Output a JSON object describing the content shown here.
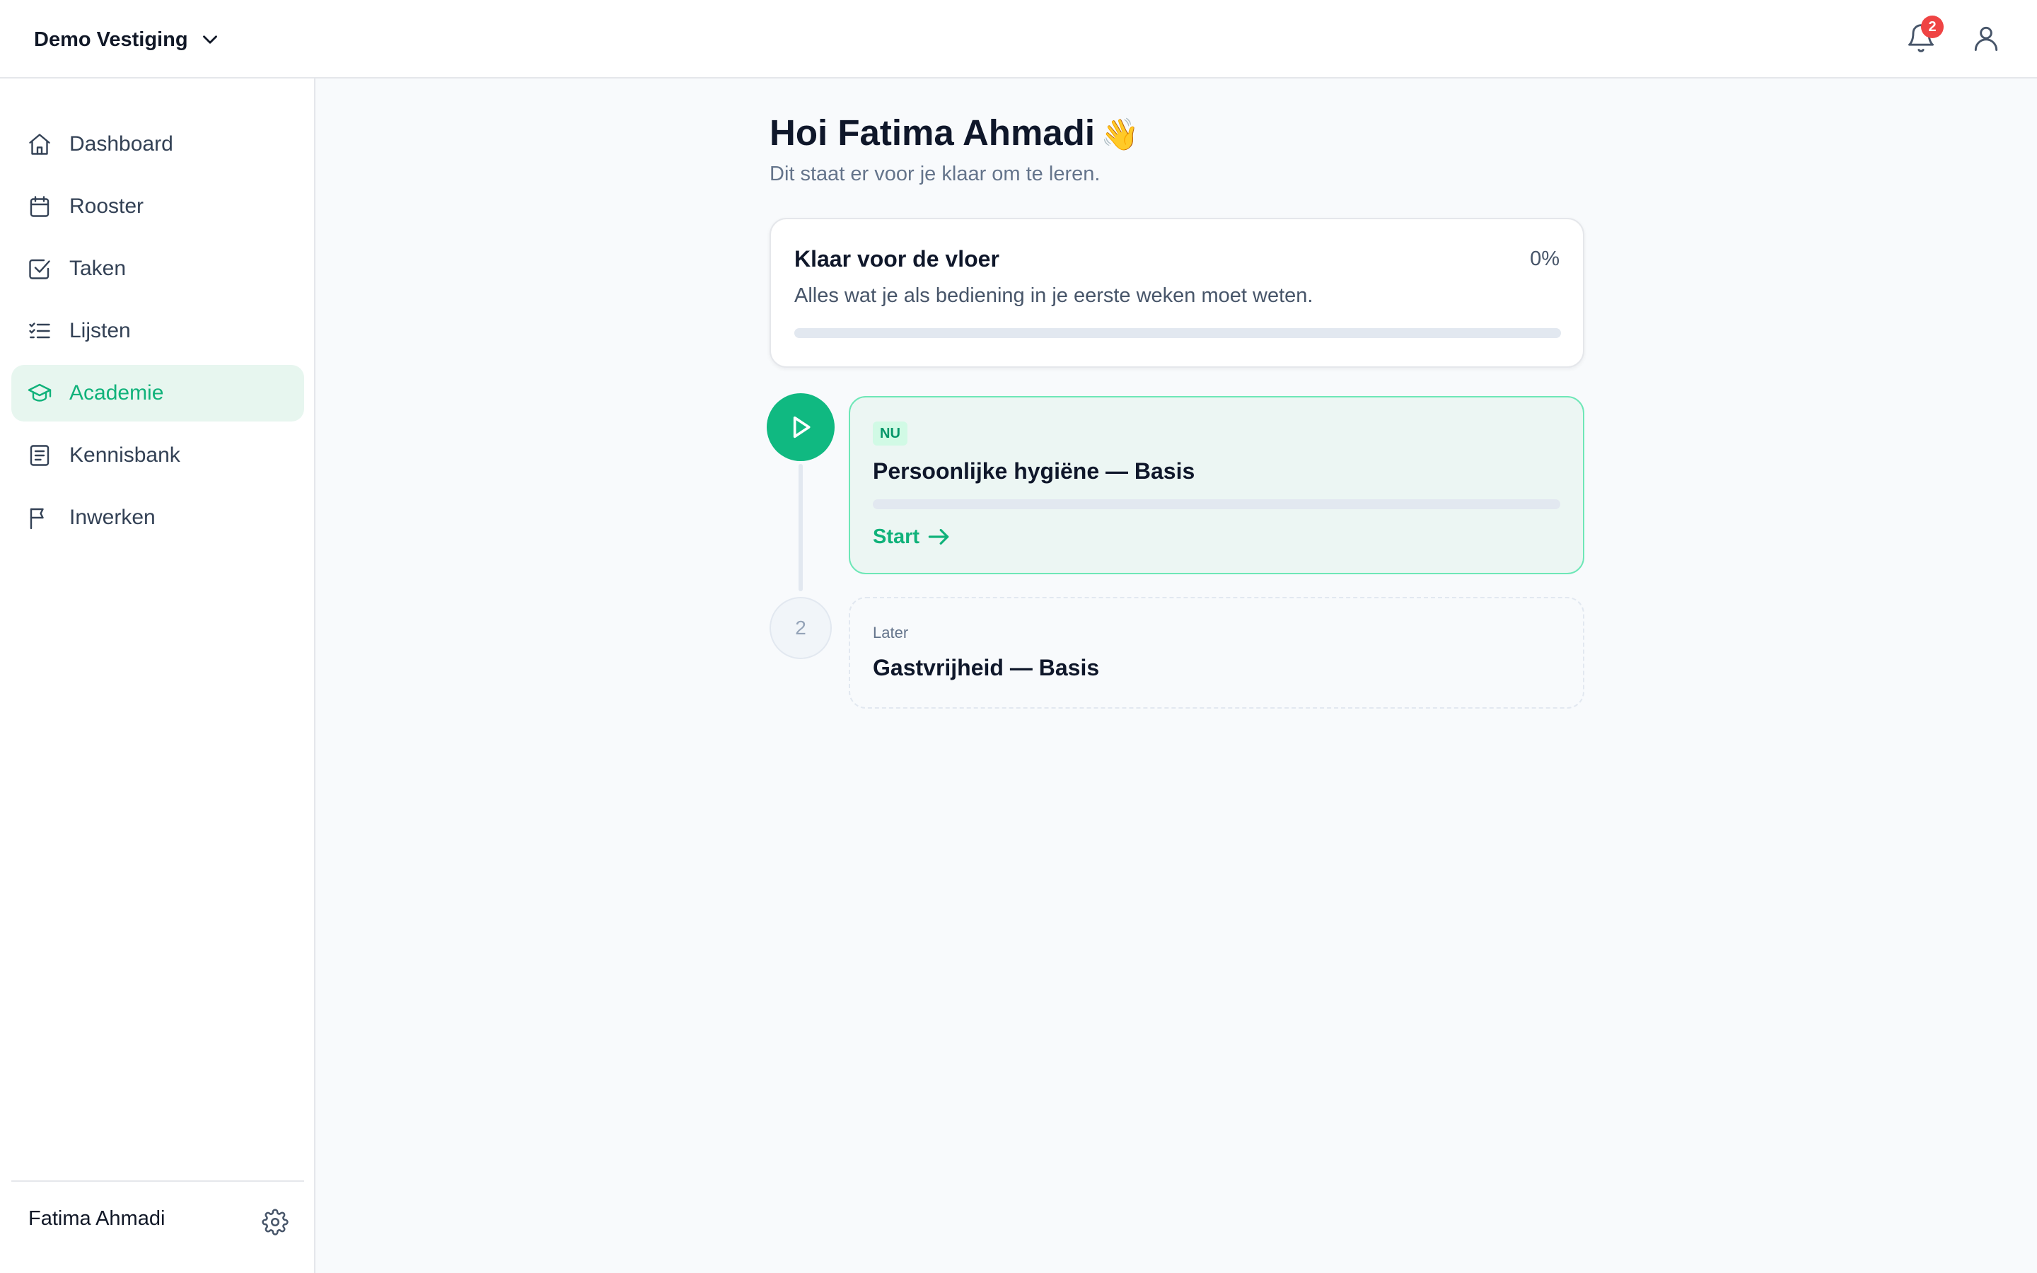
{
  "header": {
    "workspace": "Demo Vestiging",
    "notification_count": "2"
  },
  "sidebar": {
    "items": [
      {
        "label": "Dashboard",
        "icon": "home-icon"
      },
      {
        "label": "Rooster",
        "icon": "calendar-icon"
      },
      {
        "label": "Taken",
        "icon": "checkbox-icon"
      },
      {
        "label": "Lijsten",
        "icon": "list-icon"
      },
      {
        "label": "Academie",
        "icon": "graduation-cap-icon",
        "active": true
      },
      {
        "label": "Kennisbank",
        "icon": "book-icon"
      },
      {
        "label": "Inwerken",
        "icon": "flag-icon"
      }
    ],
    "user_name": "Fatima Ahmadi"
  },
  "main": {
    "greeting": "Hoi Fatima Ahmadi",
    "greeting_emoji": "👋",
    "subtitle": "Dit staat er voor je klaar om te leren.",
    "course": {
      "title": "Klaar voor de vloer",
      "progress_label": "0%",
      "progress": 0,
      "description": "Alles wat je als bediening in je eerste weken moet weten."
    },
    "lessons": [
      {
        "status_label": "NU",
        "title": "Persoonlijke hygiëne — Basis",
        "progress": 0,
        "action_label": "Start"
      },
      {
        "step_number": "2",
        "status_label": "Later",
        "title": "Gastvrijheid — Basis"
      }
    ]
  },
  "colors": {
    "accent": "#10b981",
    "accent_text": "#10b27a",
    "active_nav_bg": "#e7f6ef",
    "badge": "#ef4444"
  }
}
